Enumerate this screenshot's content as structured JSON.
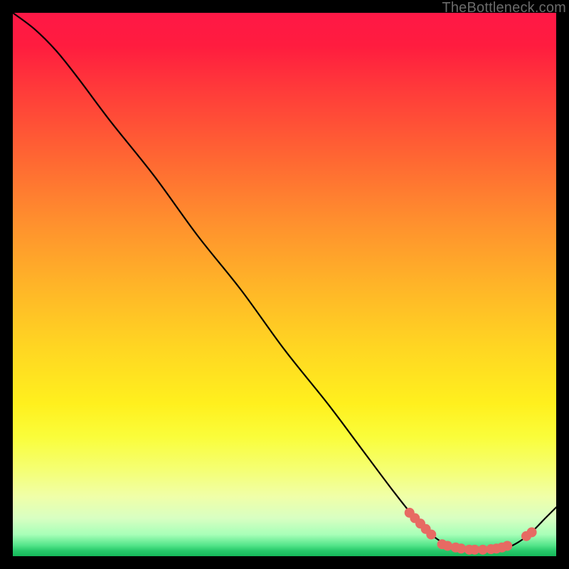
{
  "watermark": "TheBottleneck.com",
  "chart_data": {
    "type": "line",
    "title": "",
    "xlabel": "",
    "ylabel": "",
    "xlim": [
      0,
      100
    ],
    "ylim": [
      0,
      100
    ],
    "grid": false,
    "series": [
      {
        "name": "bottleneck-curve",
        "x": [
          0,
          4,
          8,
          12,
          18,
          26,
          34,
          42,
          50,
          58,
          64,
          70,
          74,
          77,
          80,
          83,
          86,
          89,
          92,
          95,
          98,
          100
        ],
        "y": [
          100,
          97,
          93,
          88,
          80,
          70,
          59,
          49,
          38,
          28,
          20,
          12,
          7,
          4,
          2,
          1,
          1,
          1,
          2,
          4,
          7,
          9
        ]
      }
    ],
    "markers": [
      {
        "name": "marker-cluster-left-1",
        "x": 73,
        "y": 8
      },
      {
        "name": "marker-cluster-left-2",
        "x": 74,
        "y": 7
      },
      {
        "name": "marker-cluster-left-3",
        "x": 75,
        "y": 6
      },
      {
        "name": "marker-cluster-left-4",
        "x": 76,
        "y": 5
      },
      {
        "name": "marker-cluster-left-5",
        "x": 77,
        "y": 4
      },
      {
        "name": "marker-valley-1",
        "x": 79,
        "y": 2.2
      },
      {
        "name": "marker-valley-2",
        "x": 80,
        "y": 1.9
      },
      {
        "name": "marker-valley-3",
        "x": 81.5,
        "y": 1.6
      },
      {
        "name": "marker-valley-4",
        "x": 82.5,
        "y": 1.4
      },
      {
        "name": "marker-valley-5",
        "x": 84,
        "y": 1.2
      },
      {
        "name": "marker-valley-6",
        "x": 85,
        "y": 1.2
      },
      {
        "name": "marker-valley-7",
        "x": 86.5,
        "y": 1.2
      },
      {
        "name": "marker-valley-8",
        "x": 88,
        "y": 1.3
      },
      {
        "name": "marker-valley-9",
        "x": 89,
        "y": 1.4
      },
      {
        "name": "marker-valley-10",
        "x": 90,
        "y": 1.6
      },
      {
        "name": "marker-valley-11",
        "x": 91,
        "y": 1.9
      },
      {
        "name": "marker-right-1",
        "x": 94.5,
        "y": 3.7
      },
      {
        "name": "marker-right-2",
        "x": 95.5,
        "y": 4.4
      }
    ],
    "background_gradient": {
      "top": "#ff1846",
      "mid": "#ffe41f",
      "bottom": "#15b85a"
    }
  }
}
